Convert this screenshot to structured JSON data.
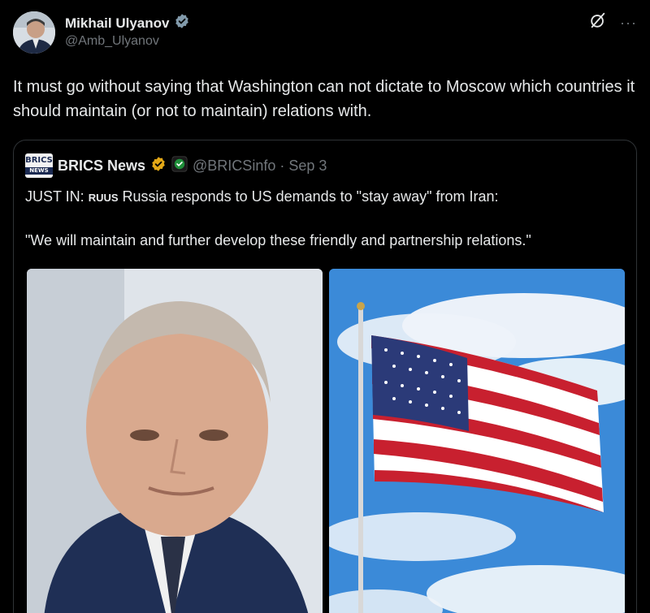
{
  "author": {
    "display_name": "Mikhail Ulyanov",
    "handle": "@Amb_Ulyanov"
  },
  "tweet": {
    "text": "It must go without saying that Washington can not dictate to Moscow which countries it  should maintain (or not to maintain) relations with."
  },
  "quoted_tweet": {
    "display_name": "BRICS News",
    "handle_time": "@BRICSinfo · Sep 3",
    "logo_text_top": "BRICS",
    "logo_text_bottom": "NEWS",
    "line1_prefix": "JUST IN: ",
    "line1_flag": "RUUS",
    "line1_rest": " Russia responds to US demands to \"stay away\" from Iran:",
    "line2": "\"We will maintain and further develop these friendly and partnership relations.\""
  },
  "colors": {
    "background": "#000000",
    "primary_text": "#e7e9ea",
    "secondary_text": "#71767b",
    "verified_badge": "#829aab",
    "affiliate_badge": "#e3a817",
    "border": "#2f3336"
  },
  "icons": [
    "avatar",
    "verified-badge-icon",
    "grok-icon",
    "more-icon",
    "gold-verified-badge-icon",
    "affiliate-badge-icon"
  ]
}
